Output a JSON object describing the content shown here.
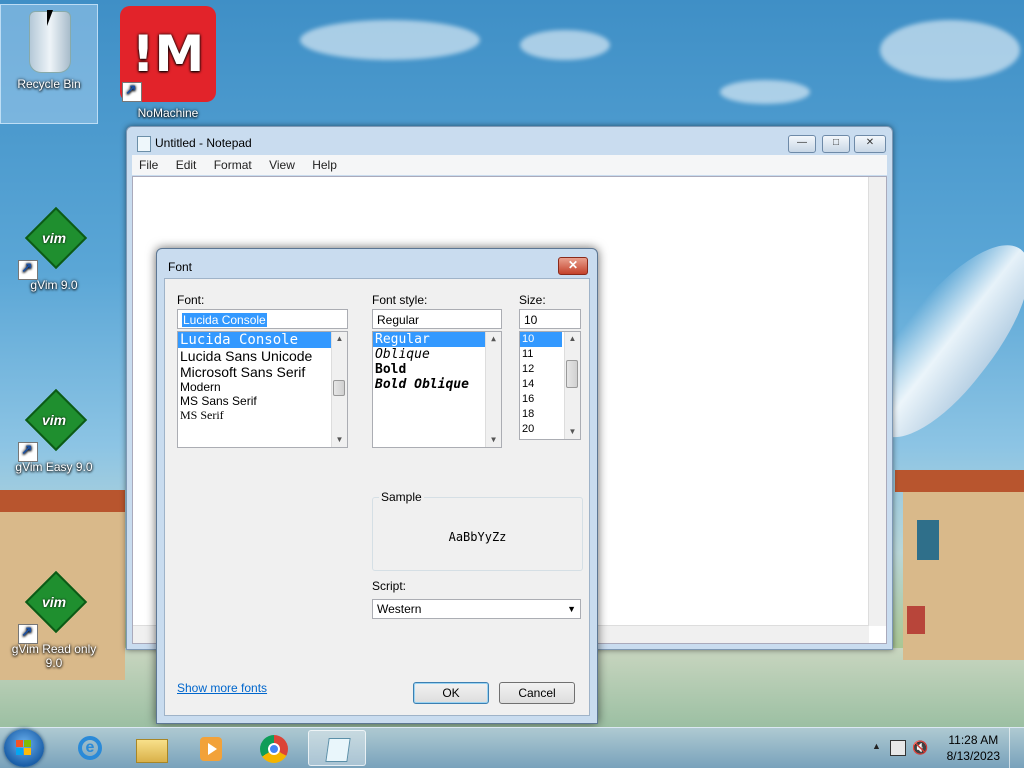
{
  "desktop": {
    "icons": [
      {
        "label": "Recycle Bin"
      },
      {
        "label": "NoMachine"
      },
      {
        "label": "gVim 9.0"
      },
      {
        "label": "gVim Easy 9.0"
      },
      {
        "label": "gVim Read only 9.0"
      }
    ],
    "nomachine_glyph": "!M",
    "vim_glyph": "vim"
  },
  "notepad": {
    "title": "Untitled - Notepad",
    "menus": [
      "File",
      "Edit",
      "Format",
      "View",
      "Help"
    ],
    "controls": {
      "minimize": "—",
      "maximize": "□",
      "close": "✕"
    }
  },
  "font_dialog": {
    "title": "Font",
    "close": "✕",
    "font_label": "Font:",
    "font_value": "Lucida Console",
    "fonts": [
      "Lucida Console",
      "Lucida Sans Unicode",
      "Microsoft Sans Serif",
      "Modern",
      "MS Sans Serif",
      "MS Serif"
    ],
    "style_label": "Font style:",
    "style_value": "Regular",
    "styles": [
      "Regular",
      "Oblique",
      "Bold",
      "Bold Oblique"
    ],
    "size_label": "Size:",
    "size_value": "10",
    "sizes": [
      "10",
      "11",
      "12",
      "14",
      "16",
      "18",
      "20"
    ],
    "sample_label": "Sample",
    "sample_text": "AaBbYyZz",
    "script_label": "Script:",
    "script_value": "Western",
    "show_more": "Show more fonts",
    "ok": "OK",
    "cancel": "Cancel"
  },
  "taskbar": {
    "time": "11:28 AM",
    "date": "8/13/2023",
    "apps": [
      "start-button",
      "internet-explorer-icon",
      "file-explorer-icon",
      "media-player-icon",
      "chrome-icon",
      "notepad-icon"
    ]
  },
  "colors": {
    "selection": "#3399ff",
    "link": "#0066cc",
    "nomachine": "#e2232a"
  }
}
